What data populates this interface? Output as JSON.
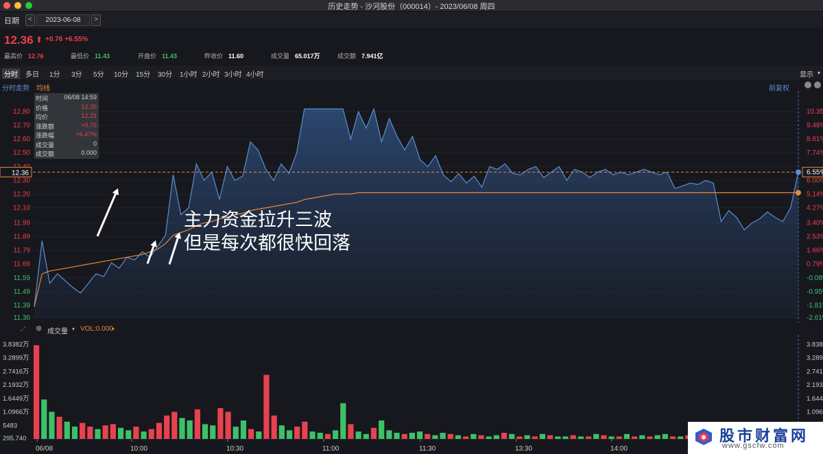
{
  "window": {
    "title": "历史走势 - 沙河股份（000014）- 2023/06/08 周四",
    "traffic_lights": [
      "#ff5f57",
      "#febc2e",
      "#28c840"
    ]
  },
  "datebar": {
    "label": "日期",
    "date": "2023-06-08",
    "prev": "<",
    "next": ">"
  },
  "quote": {
    "price": "12.36",
    "arrow": "⬆",
    "change": "+0.76 +6.55%",
    "stats": [
      {
        "k": "最高价",
        "v": "12.76",
        "color": "#ef3d4b"
      },
      {
        "k": "最低价",
        "v": "11.43",
        "color": "#3ec06a"
      },
      {
        "k": "开盘价",
        "v": "11.43",
        "color": "#3ec06a"
      },
      {
        "k": "昨收价",
        "v": "11.60",
        "color": "#ffffff"
      },
      {
        "k": "成交量",
        "v": "65.017万",
        "color": "#ffffff"
      },
      {
        "k": "成交额",
        "v": "7.941亿",
        "color": "#ffffff"
      }
    ]
  },
  "tabs": [
    "分时",
    "多日",
    "1分",
    "3分",
    "5分",
    "10分",
    "15分",
    "30分",
    "1小时",
    "2小时",
    "3小时",
    "4小时"
  ],
  "display_label": "显示",
  "subbar": {
    "left1": "分时走势",
    "left2": "均线",
    "right": "前复权"
  },
  "tooltip": [
    {
      "k": "时间",
      "v": "06/08 14:59",
      "color": "#d0d0d0"
    },
    {
      "k": "价格",
      "v": "12.35",
      "color": "#ef3d4b"
    },
    {
      "k": "均价",
      "v": "12.21",
      "color": "#ef3d4b"
    },
    {
      "k": "涨跌额",
      "v": "+0.75",
      "color": "#ef3d4b"
    },
    {
      "k": "涨跌幅",
      "v": "+6.47%",
      "color": "#ef3d4b"
    },
    {
      "k": "成交量",
      "v": "0",
      "color": "#d0d0d0"
    },
    {
      "k": "成交额",
      "v": "0.000",
      "color": "#d0d0d0"
    }
  ],
  "annotation": {
    "line1": "主力资金拉升三波",
    "line2": "但是每次都很快回落"
  },
  "volume_bar": {
    "label": "成交量",
    "vol": "VOL:0.000"
  },
  "watermark": {
    "text": "股市财富网",
    "url": "www.gscfw.com"
  },
  "chart_data": {
    "type": "line",
    "title": "",
    "price_axis": {
      "ticks": [
        "12.80",
        "12.70",
        "12.60",
        "12.50",
        "12.40",
        "12.30",
        "12.20",
        "12.10",
        "11.99",
        "11.89",
        "11.79",
        "11.69",
        "11.59",
        "11.49",
        "11.39",
        "11.30"
      ],
      "current_label": "12.36",
      "ylim": [
        11.3,
        12.85
      ]
    },
    "pct_axis": [
      "10.35%",
      "9.48%",
      "8.61%",
      "7.74%",
      "6.55%",
      "6.00%",
      "5.14%",
      "4.27%",
      "3.40%",
      "2.53%",
      "1.66%",
      "0.79%",
      "-0.08%",
      "-0.95%",
      "-1.81%",
      "-2.61%"
    ],
    "x_ticks": [
      "06/08",
      "10:00",
      "10:30",
      "11:00",
      "11:30",
      "13:30",
      "14:00"
    ],
    "prev_close": 11.6,
    "series": [
      {
        "name": "分时走势",
        "color": "#5a8fd6",
        "values": [
          11.38,
          11.86,
          11.55,
          11.62,
          11.57,
          11.52,
          11.48,
          11.55,
          11.62,
          11.6,
          11.7,
          11.66,
          11.74,
          11.72,
          11.78,
          11.74,
          11.82,
          11.9,
          12.34,
          12.05,
          12.1,
          12.42,
          12.3,
          12.36,
          12.16,
          12.4,
          12.3,
          12.33,
          12.58,
          12.52,
          12.38,
          12.3,
          12.42,
          12.35,
          12.5,
          12.82,
          12.82,
          12.82,
          12.82,
          12.82,
          12.82,
          12.6,
          12.8,
          12.68,
          12.82,
          12.58,
          12.75,
          12.62,
          12.52,
          12.62,
          12.45,
          12.4,
          12.48,
          12.34,
          12.29,
          12.35,
          12.28,
          12.33,
          12.25,
          12.4,
          12.38,
          12.42,
          12.35,
          12.34,
          12.38,
          12.4,
          12.32,
          12.36,
          12.4,
          12.3,
          12.38,
          12.36,
          12.32,
          12.36,
          12.38,
          12.34,
          12.36,
          12.34,
          12.36,
          12.38,
          12.36,
          12.34,
          12.36,
          12.24,
          12.26,
          12.28,
          12.27,
          12.3,
          12.28,
          12.0,
          12.08,
          12.03,
          11.94,
          11.99,
          12.02,
          12.07,
          12.03,
          12.0,
          12.1,
          12.36
        ]
      },
      {
        "name": "均线",
        "color": "#e88a35",
        "values": [
          11.38,
          11.62,
          11.64,
          11.65,
          11.66,
          11.67,
          11.68,
          11.69,
          11.7,
          11.71,
          11.72,
          11.73,
          11.74,
          11.75,
          11.76,
          11.78,
          11.8,
          11.84,
          11.9,
          11.92,
          11.94,
          11.97,
          11.99,
          12.0,
          12.02,
          12.03,
          12.05,
          12.06,
          12.08,
          12.09,
          12.1,
          12.11,
          12.12,
          12.13,
          12.14,
          12.16,
          12.17,
          12.18,
          12.19,
          12.2,
          12.2,
          12.2,
          12.21,
          12.21,
          12.21,
          12.21,
          12.21,
          12.21,
          12.21,
          12.21,
          12.21,
          12.21,
          12.21,
          12.21,
          12.21,
          12.21,
          12.21,
          12.21,
          12.21,
          12.21,
          12.21,
          12.21,
          12.21,
          12.21,
          12.21,
          12.21,
          12.21,
          12.21,
          12.21,
          12.21,
          12.21,
          12.21,
          12.21,
          12.21,
          12.21,
          12.21,
          12.21,
          12.21,
          12.21,
          12.21,
          12.21,
          12.21,
          12.21,
          12.21,
          12.21,
          12.21,
          12.21,
          12.21,
          12.21,
          12.21,
          12.21,
          12.21,
          12.21,
          12.21,
          12.21,
          12.21,
          12.21,
          12.21,
          12.21,
          12.21
        ]
      }
    ],
    "volume": {
      "ticks": [
        "3.8382万",
        "3.2899万",
        "2.7416万",
        "2.1932万",
        "1.6449万",
        "1.0966万",
        "5483",
        "295.740"
      ],
      "ylim": [
        0,
        40000
      ],
      "values": [
        38000,
        16000,
        11000,
        9000,
        7000,
        5000,
        6500,
        5000,
        4000,
        5500,
        6000,
        4500,
        3500,
        5000,
        3000,
        4000,
        6500,
        9500,
        11000,
        8500,
        7500,
        12000,
        6000,
        5500,
        12500,
        11000,
        5000,
        7500,
        4000,
        3000,
        26000,
        9500,
        5500,
        3500,
        5000,
        7000,
        3000,
        2500,
        2000,
        3500,
        14500,
        6000,
        3000,
        2000,
        4500,
        7500,
        3500,
        2500,
        2000,
        2500,
        3000,
        2000,
        1500,
        2500,
        2000,
        1500,
        1000,
        2000,
        1500,
        1000,
        1500,
        2500,
        2000,
        1000,
        1500,
        1000,
        2000,
        1500,
        1000,
        1000,
        1500,
        1000,
        1000,
        2000,
        1500,
        1000,
        1000,
        2000,
        1000,
        1500,
        1000,
        1500,
        2000,
        1000,
        1000,
        1500,
        1000,
        2000,
        1000,
        2500,
        1500,
        1000,
        1500,
        1000,
        2000,
        1000,
        1500,
        1000,
        1000,
        1500
      ],
      "up": [
        1,
        0,
        0,
        1,
        0,
        0,
        1,
        1,
        0,
        1,
        1,
        0,
        0,
        1,
        0,
        1,
        1,
        1,
        1,
        0,
        0,
        1,
        0,
        0,
        1,
        1,
        0,
        0,
        1,
        0,
        1,
        1,
        0,
        0,
        1,
        1,
        0,
        0,
        1,
        0,
        0,
        1,
        0,
        0,
        1,
        0,
        0,
        0,
        1,
        0,
        0,
        1,
        0,
        0,
        1,
        0,
        1,
        0,
        1,
        0,
        0,
        1,
        0,
        1,
        0,
        1,
        0,
        1,
        0,
        0,
        1,
        0,
        1,
        0,
        1,
        0,
        1,
        0,
        1,
        0,
        1,
        0,
        0,
        1,
        0,
        1,
        0,
        1,
        0,
        0,
        1,
        0,
        1,
        0,
        0,
        1,
        0,
        1,
        0,
        1
      ]
    }
  }
}
